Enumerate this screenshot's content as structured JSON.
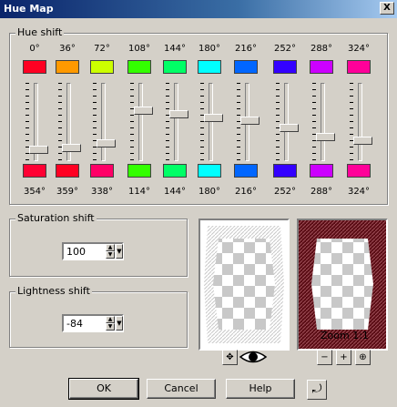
{
  "window": {
    "title": "Hue Map",
    "close_glyph": "X"
  },
  "hue_shift": {
    "label": "Hue shift",
    "columns": [
      {
        "top": "0°",
        "top_color": "#ff0022",
        "bottom": "354°",
        "bottom_color": "#ff0033",
        "level": 0.88
      },
      {
        "top": "36°",
        "top_color": "#ff9900",
        "bottom": "359°",
        "bottom_color": "#ff0022",
        "level": 0.86
      },
      {
        "top": "72°",
        "top_color": "#ccff00",
        "bottom": "338°",
        "bottom_color": "#ff0066",
        "level": 0.79
      },
      {
        "top": "108°",
        "top_color": "#33ff00",
        "bottom": "114°",
        "bottom_color": "#33ff00",
        "level": 0.33
      },
      {
        "top": "144°",
        "top_color": "#00ff66",
        "bottom": "144°",
        "bottom_color": "#00ff66",
        "level": 0.38
      },
      {
        "top": "180°",
        "top_color": "#00ffff",
        "bottom": "180°",
        "bottom_color": "#00ffff",
        "level": 0.43
      },
      {
        "top": "216°",
        "top_color": "#0066ff",
        "bottom": "216°",
        "bottom_color": "#0066ff",
        "level": 0.48
      },
      {
        "top": "252°",
        "top_color": "#3300ff",
        "bottom": "252°",
        "bottom_color": "#3300ff",
        "level": 0.58
      },
      {
        "top": "288°",
        "top_color": "#cc00ff",
        "bottom": "288°",
        "bottom_color": "#cc00ff",
        "level": 0.71
      },
      {
        "top": "324°",
        "top_color": "#ff0099",
        "bottom": "324°",
        "bottom_color": "#ff0099",
        "level": 0.76
      }
    ]
  },
  "saturation": {
    "label": "Saturation shift",
    "value": "100"
  },
  "lightness": {
    "label": "Lightness shift",
    "value": "-84"
  },
  "preview": {
    "zoom_label": "Zoom 1:1"
  },
  "buttons": {
    "ok": "OK",
    "cancel": "Cancel",
    "help": "Help"
  }
}
